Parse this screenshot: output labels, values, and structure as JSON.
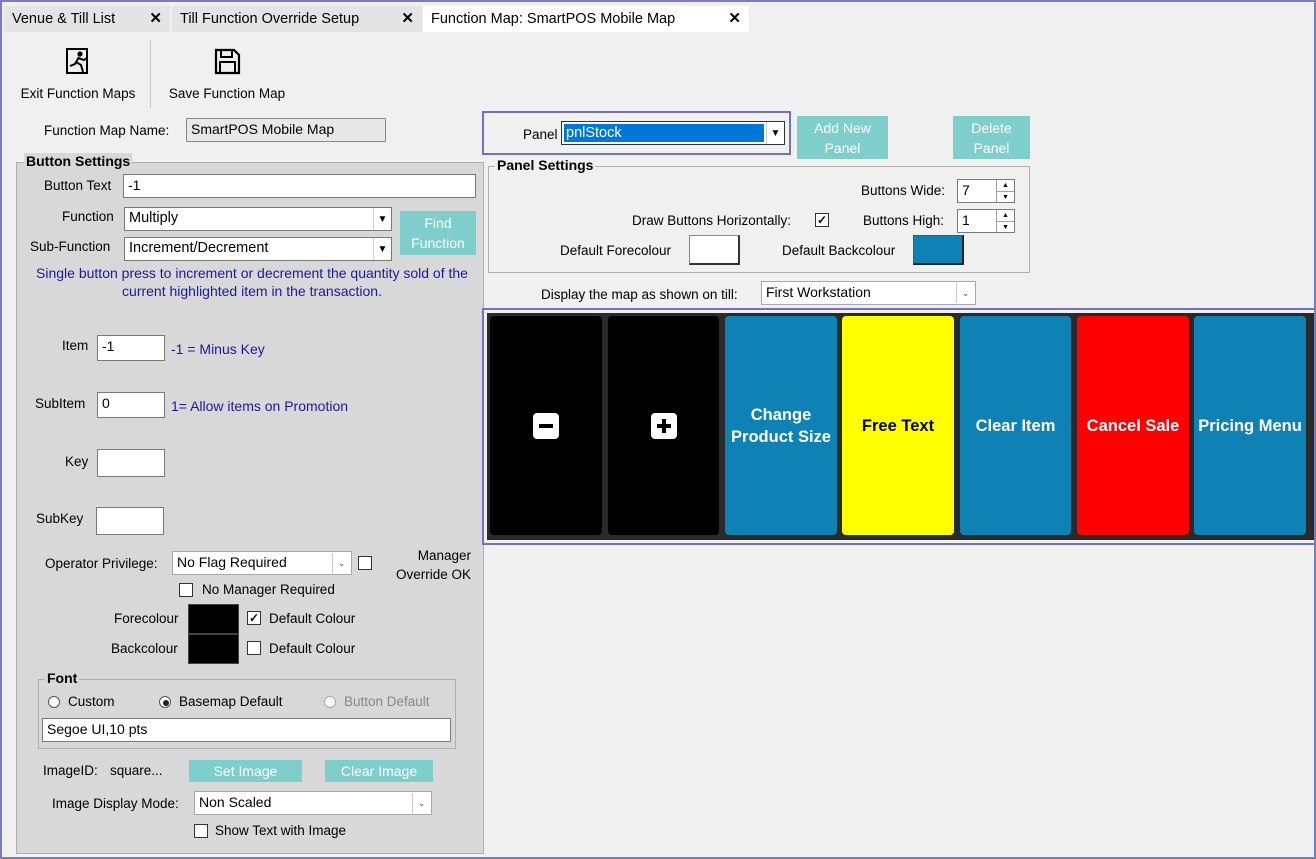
{
  "tabs": [
    {
      "label": "Venue & Till List"
    },
    {
      "label": "Till Function Override Setup"
    },
    {
      "label": "Function Map: SmartPOS Mobile Map"
    }
  ],
  "toolbar": {
    "exit_label": "Exit Function Maps",
    "save_label": "Save Function Map"
  },
  "function_map": {
    "name_label": "Function Map Name:",
    "name_value": "SmartPOS Mobile Map"
  },
  "button_settings": {
    "title": "Button Settings",
    "button_text_label": "Button Text",
    "button_text_value": "-1",
    "function_label": "Function",
    "function_value": "Multiply",
    "sub_function_label": "Sub-Function",
    "sub_function_value": "Increment/Decrement",
    "find_function_label": "Find Function",
    "description": "Single button press to increment or decrement the quantity sold of the current highlighted item in the transaction.",
    "item_label": "Item",
    "item_value": "-1",
    "item_hint": "-1 = Minus Key",
    "subitem_label": "SubItem",
    "subitem_value": "0",
    "subitem_hint": "1= Allow items on Promotion",
    "key_label": "Key",
    "key_value": "",
    "subkey_label": "SubKey",
    "subkey_value": "",
    "operator_privilege_label": "Operator Privilege:",
    "operator_privilege_value": "No Flag Required",
    "manager_override_label": "Manager Override OK",
    "manager_override_checked": false,
    "no_manager_label": "No Manager Required",
    "no_manager_checked": false,
    "forecolour_label": "Forecolour",
    "forecolour_value": "#000000",
    "forecolour_default_label": "Default Colour",
    "forecolour_default_checked": true,
    "backcolour_label": "Backcolour",
    "backcolour_value": "#000000",
    "backcolour_default_label": "Default Colour",
    "backcolour_default_checked": false
  },
  "font": {
    "title": "Font",
    "options": [
      "Custom",
      "Basemap Default",
      "Button Default"
    ],
    "selected": "Basemap Default",
    "value": "Segoe UI,10 pts"
  },
  "image": {
    "id_label": "ImageID:",
    "id_value": "square...",
    "set_label": "Set Image",
    "clear_label": "Clear Image",
    "display_mode_label": "Image Display Mode:",
    "display_mode_value": "Non Scaled",
    "show_text_label": "Show Text with Image",
    "show_text_checked": false
  },
  "panel": {
    "label": "Panel",
    "value": "pnlStock",
    "add_label": "Add New Panel",
    "delete_label": "Delete Panel"
  },
  "panel_settings": {
    "title": "Panel Settings",
    "buttons_wide_label": "Buttons Wide:",
    "buttons_wide_value": "7",
    "buttons_high_label": "Buttons High:",
    "buttons_high_value": "1",
    "draw_horizontal_label": "Draw Buttons Horizontally:",
    "draw_horizontal_checked": true,
    "default_forecolour_label": "Default Forecolour",
    "default_forecolour_value": "#ffffff",
    "default_backcolour_label": "Default Backcolour",
    "default_backcolour_value": "#0e82b4"
  },
  "display_map": {
    "label": "Display the map as shown on till:",
    "value": "First Workstation"
  },
  "tiles": [
    {
      "label": "",
      "icon": "minus-icon",
      "bg": "#000000",
      "fg": "#ffffff"
    },
    {
      "label": "",
      "icon": "plus-icon",
      "bg": "#000000",
      "fg": "#ffffff"
    },
    {
      "label": "Change Product Size",
      "bg": "#0e82b4",
      "fg": "#ffffff"
    },
    {
      "label": "Free Text",
      "bg": "#ffff00",
      "fg": "#000000"
    },
    {
      "label": "Clear Item",
      "bg": "#0e82b4",
      "fg": "#ffffff"
    },
    {
      "label": "Cancel Sale",
      "bg": "#ff0000",
      "fg": "#ffffff"
    },
    {
      "label": "Pricing Menu",
      "bg": "#0e82b4",
      "fg": "#ffffff"
    }
  ],
  "colors": {
    "accent_teal": "#7ecfcc",
    "highlight_border": "#7070c8",
    "selection_blue": "#0078d7"
  }
}
